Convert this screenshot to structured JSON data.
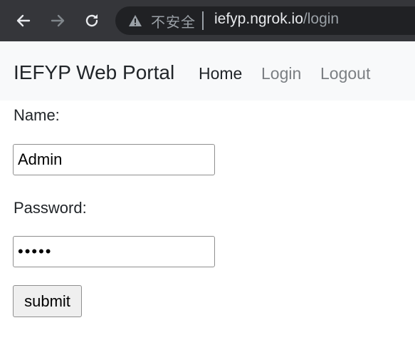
{
  "browser": {
    "back_icon": "arrow-left-icon",
    "forward_icon": "arrow-right-icon",
    "reload_icon": "reload-icon",
    "security_icon": "warning-triangle-icon",
    "security_label": "不安全",
    "url_host": "iefyp.ngrok.io",
    "url_path": "/login"
  },
  "navbar": {
    "brand": "IEFYP Web Portal",
    "links": [
      "Home",
      "Login",
      "Logout"
    ]
  },
  "form": {
    "name_label": "Name:",
    "name_value": "Admin",
    "password_label": "Password:",
    "password_value": "admin",
    "submit_label": "submit"
  },
  "colors": {
    "chrome_bg": "#35363a",
    "omnibox_bg": "#202124",
    "navbar_bg": "#f8f9fa",
    "nav_link_muted": "#7b7f83"
  }
}
